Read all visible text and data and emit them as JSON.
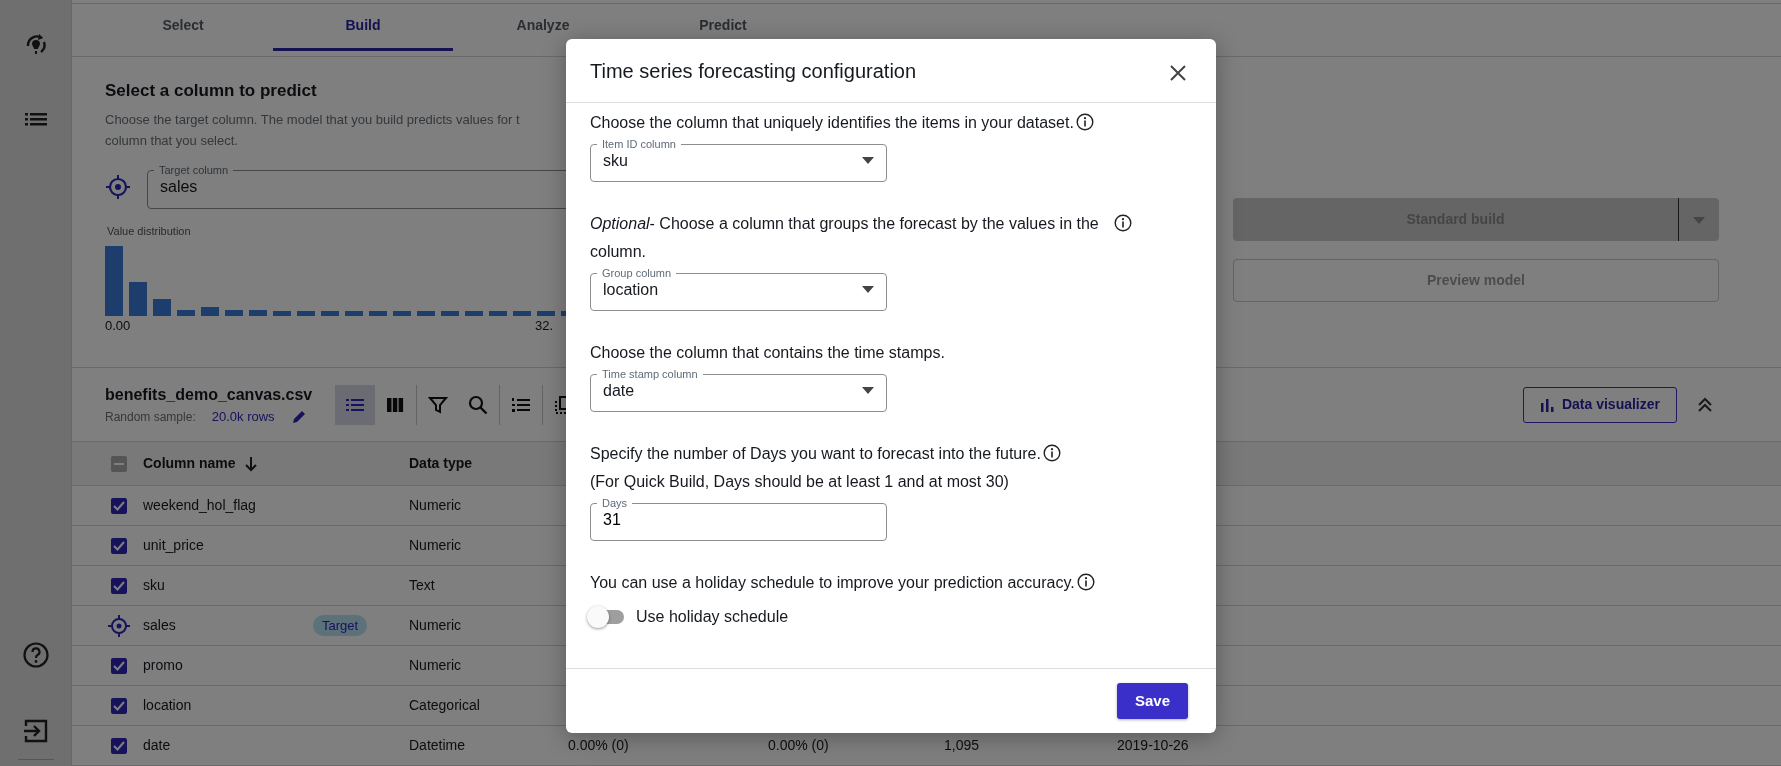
{
  "tabs": [
    {
      "label": "Select",
      "selected": false
    },
    {
      "label": "Build",
      "selected": true
    },
    {
      "label": "Analyze",
      "selected": false
    },
    {
      "label": "Predict",
      "selected": false
    }
  ],
  "target_section": {
    "title": "Select a column to predict",
    "description_lines": [
      "Choose the target column. The model that you build predicts values for t",
      "column that you select."
    ],
    "target_field": {
      "label": "Target column",
      "value": "sales"
    },
    "chart": {
      "label": "Value distribution",
      "axis_min": "0.00",
      "axis_max": "32."
    }
  },
  "build_actions": {
    "standard_build": "Standard build",
    "preview_model": "Preview model",
    "disabled": true
  },
  "dataset": {
    "file_name": "benefits_demo_canvas.csv",
    "sample_label": "Random sample:",
    "sample_value": "20.0k rows",
    "views": [
      {
        "selected": true
      },
      {
        "selected": false
      }
    ],
    "data_visualizer": "Data visualizer"
  },
  "table": {
    "select_all_indeterminate": true,
    "columns": [
      "Column name",
      "Data type"
    ],
    "rows": [
      {
        "kind": "checkbox",
        "checked": true,
        "name": "weekend_hol_flag",
        "data_type": "Numeric"
      },
      {
        "kind": "checkbox",
        "checked": true,
        "name": "unit_price",
        "data_type": "Numeric"
      },
      {
        "kind": "checkbox",
        "checked": true,
        "name": "sku",
        "data_type": "Text"
      },
      {
        "kind": "target",
        "name": "sales",
        "badge": "Target",
        "data_type": "Numeric"
      },
      {
        "kind": "checkbox",
        "checked": true,
        "name": "promo",
        "data_type": "Numeric"
      },
      {
        "kind": "checkbox",
        "checked": true,
        "name": "location",
        "data_type": "Categorical"
      },
      {
        "kind": "checkbox",
        "checked": true,
        "name": "date",
        "data_type": "Datetime",
        "values": [
          "0.00% (0)",
          "0.00% (0)",
          "1,095",
          "2019-10-26"
        ]
      }
    ]
  },
  "dialog": {
    "title": "Time series forecasting configuration",
    "sections": [
      {
        "text": "Choose the column that uniquely identifies the items in your dataset.",
        "info": true,
        "field": {
          "kind": "select",
          "label": "Item ID column",
          "value": "sku"
        }
      },
      {
        "text": "*Optional*- Choose a column that groups the forecast by the values in the column.",
        "info": true,
        "field": {
          "kind": "select",
          "label": "Group column",
          "value": "location"
        }
      },
      {
        "text": "Choose the column that contains the time stamps.",
        "info": false,
        "field": {
          "kind": "select",
          "label": "Time stamp column",
          "value": "date"
        }
      },
      {
        "text": "Specify the number of Days you want to forecast into the future.",
        "info": true,
        "note": "(For Quick Build, Days should be at least 1 and at most 30)",
        "field": {
          "kind": "input",
          "label": "Days",
          "value": "31"
        }
      },
      {
        "text": "You can use a holiday schedule to improve your prediction accuracy.",
        "info": true,
        "toggle": {
          "label": "Use holiday schedule",
          "on": false
        }
      }
    ],
    "save": "Save"
  }
}
